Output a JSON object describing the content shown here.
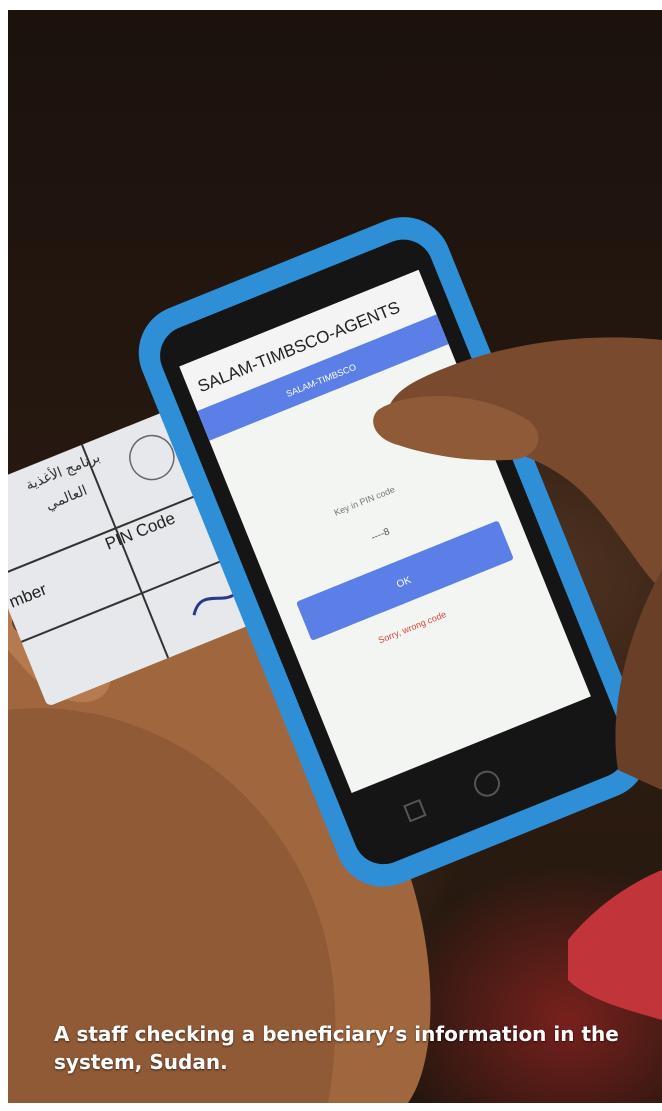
{
  "caption": "A staff checking a beneficiary’s information in the system, Sudan.",
  "device": {
    "app_title": "SALAM-TIMBSCO-AGENTS",
    "header_text": "SALAM-TIMBSCO",
    "prompt": "Key in PIN code",
    "pin_value": "----8",
    "ok_label": "OK",
    "error_text": "Sorry, wrong code"
  },
  "card": {
    "arabic_line1": "برنامج الأغذية",
    "arabic_line2": "العالمي",
    "pin_label": "PIN Code",
    "number_label": "mber"
  },
  "colors": {
    "case_blue": "#2f8fd6",
    "app_bar": "#5b7fe6",
    "ok_button": "#5b7fe6",
    "error_text": "#e0443a",
    "screen_bg": "#f2f5f2"
  }
}
